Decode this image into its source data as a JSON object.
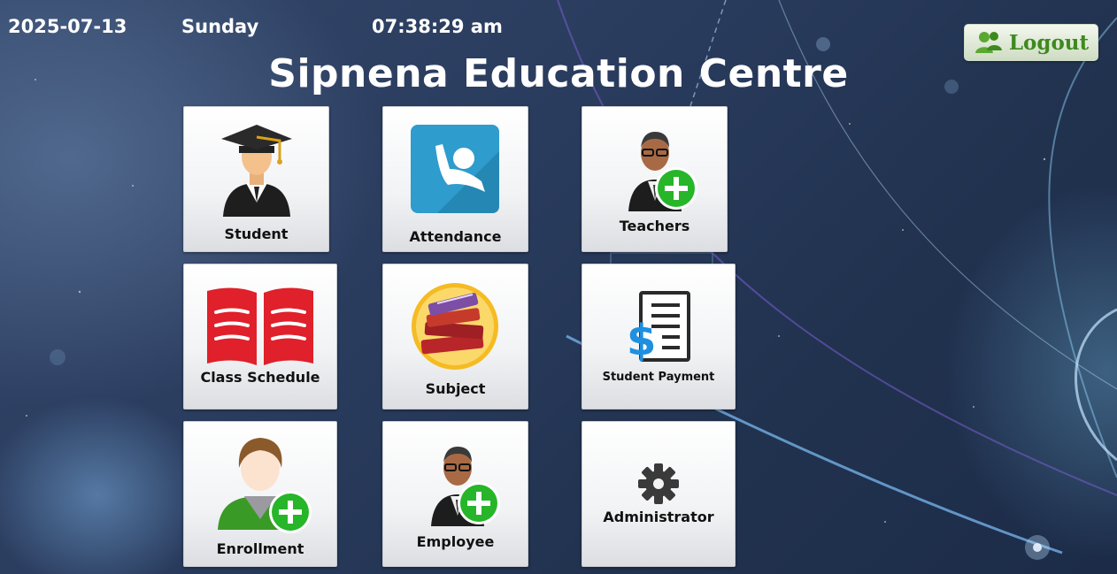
{
  "header": {
    "date": "2025-07-13",
    "day": "Sunday",
    "time": "07:38:29 am",
    "title": "Sipnena Education Centre",
    "logout_label": "Logout"
  },
  "tiles": {
    "student": {
      "label": "Student",
      "icon": "graduate-icon"
    },
    "attendance": {
      "label": "Attendance",
      "icon": "attendance-icon"
    },
    "teachers": {
      "label": "Teachers",
      "icon": "teacher-add-icon"
    },
    "class_schedule": {
      "label": "Class Schedule",
      "icon": "open-book-icon"
    },
    "subject": {
      "label": "Subject",
      "icon": "books-icon"
    },
    "student_payment": {
      "label": "Student Payment",
      "icon": "payment-document-icon"
    },
    "enrollment": {
      "label": "Enrollment",
      "icon": "user-add-icon"
    },
    "employee": {
      "label": "Employee",
      "icon": "employee-add-icon"
    },
    "administrator": {
      "label": "Administrator",
      "icon": "gear-icon"
    }
  },
  "colors": {
    "background": "#2a3c5e",
    "tile": "#f2f3f5",
    "logout_text": "#3f8a1f",
    "attendance_icon": "#2e9ccc",
    "class_schedule_icon": "#e0202a",
    "add_badge": "#27b52a"
  }
}
